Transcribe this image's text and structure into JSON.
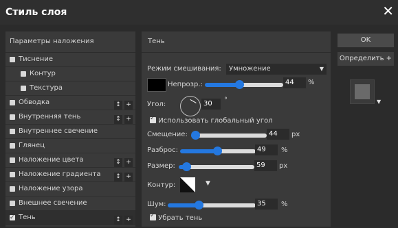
{
  "window": {
    "title": "Стиль слоя",
    "close_glyph": "✕"
  },
  "left_panel": {
    "header": "Параметры наложения",
    "items": [
      {
        "label": "Тиснение",
        "checked": false,
        "indent": 0,
        "buttons": false
      },
      {
        "label": "Контур",
        "checked": false,
        "indent": 1,
        "buttons": false
      },
      {
        "label": "Текстура",
        "checked": false,
        "indent": 1,
        "buttons": false
      },
      {
        "label": "Обводка",
        "checked": false,
        "indent": 0,
        "buttons": true
      },
      {
        "label": "Внутренняя тень",
        "checked": false,
        "indent": 0,
        "buttons": true
      },
      {
        "label": "Внутреннее свечение",
        "checked": false,
        "indent": 0,
        "buttons": false
      },
      {
        "label": "Глянец",
        "checked": false,
        "indent": 0,
        "buttons": false
      },
      {
        "label": "Наложение цвета",
        "checked": false,
        "indent": 0,
        "buttons": true
      },
      {
        "label": "Наложение градиента",
        "checked": false,
        "indent": 0,
        "buttons": true
      },
      {
        "label": "Наложение узора",
        "checked": false,
        "indent": 0,
        "buttons": false
      },
      {
        "label": "Внешнее свечение",
        "checked": false,
        "indent": 0,
        "buttons": false
      },
      {
        "label": "Тень",
        "checked": true,
        "indent": 0,
        "buttons": true
      }
    ],
    "button_glyphs": {
      "move": "↕",
      "add": "+"
    }
  },
  "shadow_panel": {
    "header": "Тень",
    "blend_mode_label": "Режим смешивания:",
    "blend_mode_value": "Умножение",
    "color": "#000000",
    "opacity": {
      "label": "Непрозр.:",
      "value": "44",
      "unit": "%",
      "fraction": 0.44
    },
    "angle": {
      "label": "Угол:",
      "value": "30",
      "unit": "°"
    },
    "global_angle": {
      "label": "Использовать глобальный угол",
      "checked": true
    },
    "offset": {
      "label": "Смещение:",
      "value": "44",
      "unit": "px",
      "fraction": 0.05
    },
    "spread": {
      "label": "Разброс:",
      "value": "49",
      "unit": "%",
      "fraction": 0.49
    },
    "size": {
      "label": "Размер:",
      "value": "59",
      "unit": "px",
      "fraction": 0.1
    },
    "contour_label": "Контур:",
    "noise": {
      "label": "Шум:",
      "value": "35",
      "unit": "%",
      "fraction": 0.35
    },
    "knockout": {
      "label": "Убрать тень",
      "checked": true
    }
  },
  "right_panel": {
    "ok_label": "OK",
    "define_label": "Определить +"
  },
  "colors": {
    "accent": "#2478e0",
    "panel": "#3a3a3a",
    "background": "#2b2b2b"
  }
}
